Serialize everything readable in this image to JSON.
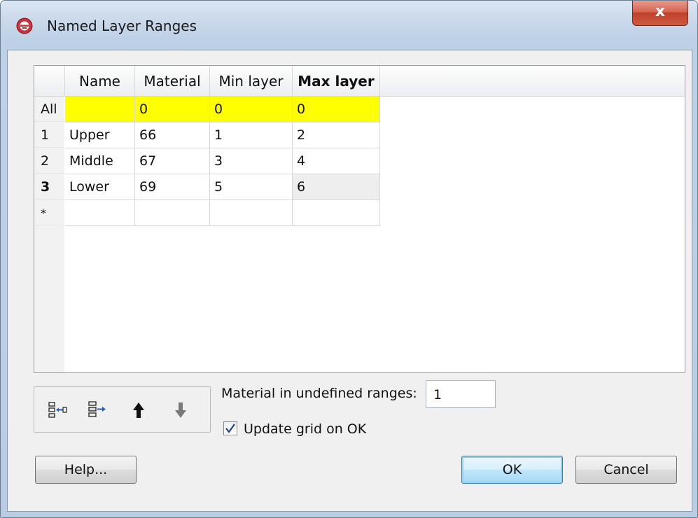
{
  "window": {
    "title": "Named Layer Ranges",
    "close_label": "x"
  },
  "grid": {
    "columns": [
      "Name",
      "Material",
      "Min layer",
      "Max layer"
    ],
    "rows": [
      {
        "header": "All",
        "name": "",
        "material": "0",
        "min": "0",
        "max": "0"
      },
      {
        "header": "1",
        "name": "Upper",
        "material": "66",
        "min": "1",
        "max": "2"
      },
      {
        "header": "2",
        "name": "Middle",
        "material": "67",
        "min": "3",
        "max": "4"
      },
      {
        "header": "3",
        "name": "Lower",
        "material": "69",
        "min": "5",
        "max": "6"
      },
      {
        "header": "*",
        "name": "",
        "material": "",
        "min": "",
        "max": ""
      }
    ]
  },
  "toolbar": {
    "buttons": [
      "insert-row-icon",
      "add-row-icon",
      "move-up-icon",
      "move-down-icon"
    ]
  },
  "material_undefined": {
    "label": "Material in undefined ranges:",
    "value": "1"
  },
  "update_grid": {
    "label": "Update grid on OK",
    "checked": true
  },
  "buttons": {
    "help": "Help...",
    "ok": "OK",
    "cancel": "Cancel"
  },
  "colors": {
    "highlight_row": "#ffff00",
    "accent": "#3c7fb1"
  }
}
